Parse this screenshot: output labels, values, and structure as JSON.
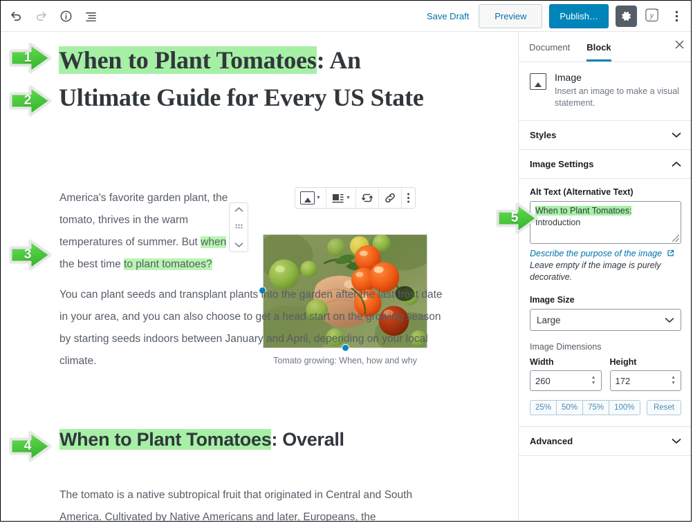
{
  "topbar": {
    "icons": [
      {
        "name": "undo-icon",
        "label": "Undo"
      },
      {
        "name": "redo-icon",
        "label": "Redo"
      },
      {
        "name": "info-icon",
        "label": "Content structure"
      },
      {
        "name": "list-view-icon",
        "label": "Block navigation"
      }
    ],
    "save_draft": "Save Draft",
    "preview": "Preview",
    "publish": "Publish…",
    "settings_icon": "gear-icon",
    "yoast_icon": "yoast-seo-icon",
    "more_icon": "kebab-menu-icon"
  },
  "editor": {
    "title_part_highlighted": "When to Plant Tomatoes",
    "title_part_rest": ": An Ultimate Guide for Every US State",
    "paragraph1": {
      "before": "America's favorite garden plant, the tomato, thrives in the warm temperatures of summer. But ",
      "hl1": "when",
      "mid": " is the best time ",
      "hl2": "to plant tomatoes?"
    },
    "paragraph2": "You can plant seeds and transplant plants into the garden after the last frost date in your area, and you can also choose to get a head start on the growing season by starting seeds indoors between January and April, depending on your local climate.",
    "heading2_highlighted": "When to Plant Tomatoes",
    "heading2_rest": ": Overall",
    "paragraph3": "The tomato is a native subtropical fruit that originated in Central and South America. Cultivated by Native Americans and later, Europeans, the",
    "caption": "Tomato growing: When, how and why",
    "block_toolbar": [
      {
        "name": "image-block-type-icon",
        "label": "Change block type"
      },
      {
        "name": "align-icon",
        "label": "Change alignment"
      },
      {
        "name": "crop-icon",
        "label": "Crop"
      },
      {
        "name": "link-icon",
        "label": "Insert link"
      },
      {
        "name": "kebab-menu-icon",
        "label": "More options"
      }
    ],
    "mover": {
      "up": "Move up",
      "drag": "Drag block",
      "down": "Move down"
    }
  },
  "sidebar": {
    "tabs": [
      {
        "label": "Document",
        "active": false
      },
      {
        "label": "Block",
        "active": true
      }
    ],
    "close_label": "Close settings",
    "block": {
      "name": "Image",
      "description": "Insert an image to make a visual statement."
    },
    "styles_panel": "Styles",
    "image_settings_panel": "Image Settings",
    "alt_text_label": "Alt Text (Alternative Text)",
    "alt_text_highlighted": "When to Plant Tomatoes:",
    "alt_text_rest": "Introduction",
    "alt_help_link": "Describe the purpose of the image",
    "alt_help_text": "Leave empty if the image is purely decorative.",
    "image_size_label": "Image Size",
    "image_size_value": "Large",
    "image_dimensions_label": "Image Dimensions",
    "width_label": "Width",
    "width_value": "260",
    "height_label": "Height",
    "height_value": "172",
    "percent_buttons": [
      "25%",
      "50%",
      "75%",
      "100%"
    ],
    "reset_label": "Reset",
    "advanced_panel": "Advanced"
  },
  "markers": [
    {
      "number": "1"
    },
    {
      "number": "2"
    },
    {
      "number": "3"
    },
    {
      "number": "4"
    },
    {
      "number": "5"
    }
  ],
  "colors": {
    "accent_blue": "#0085ba",
    "link_blue": "#0073aa",
    "highlight_green": "#a6f0a6",
    "marker_green": "#45c53a",
    "text_dark": "#32373c",
    "text_muted": "#6c7781"
  }
}
